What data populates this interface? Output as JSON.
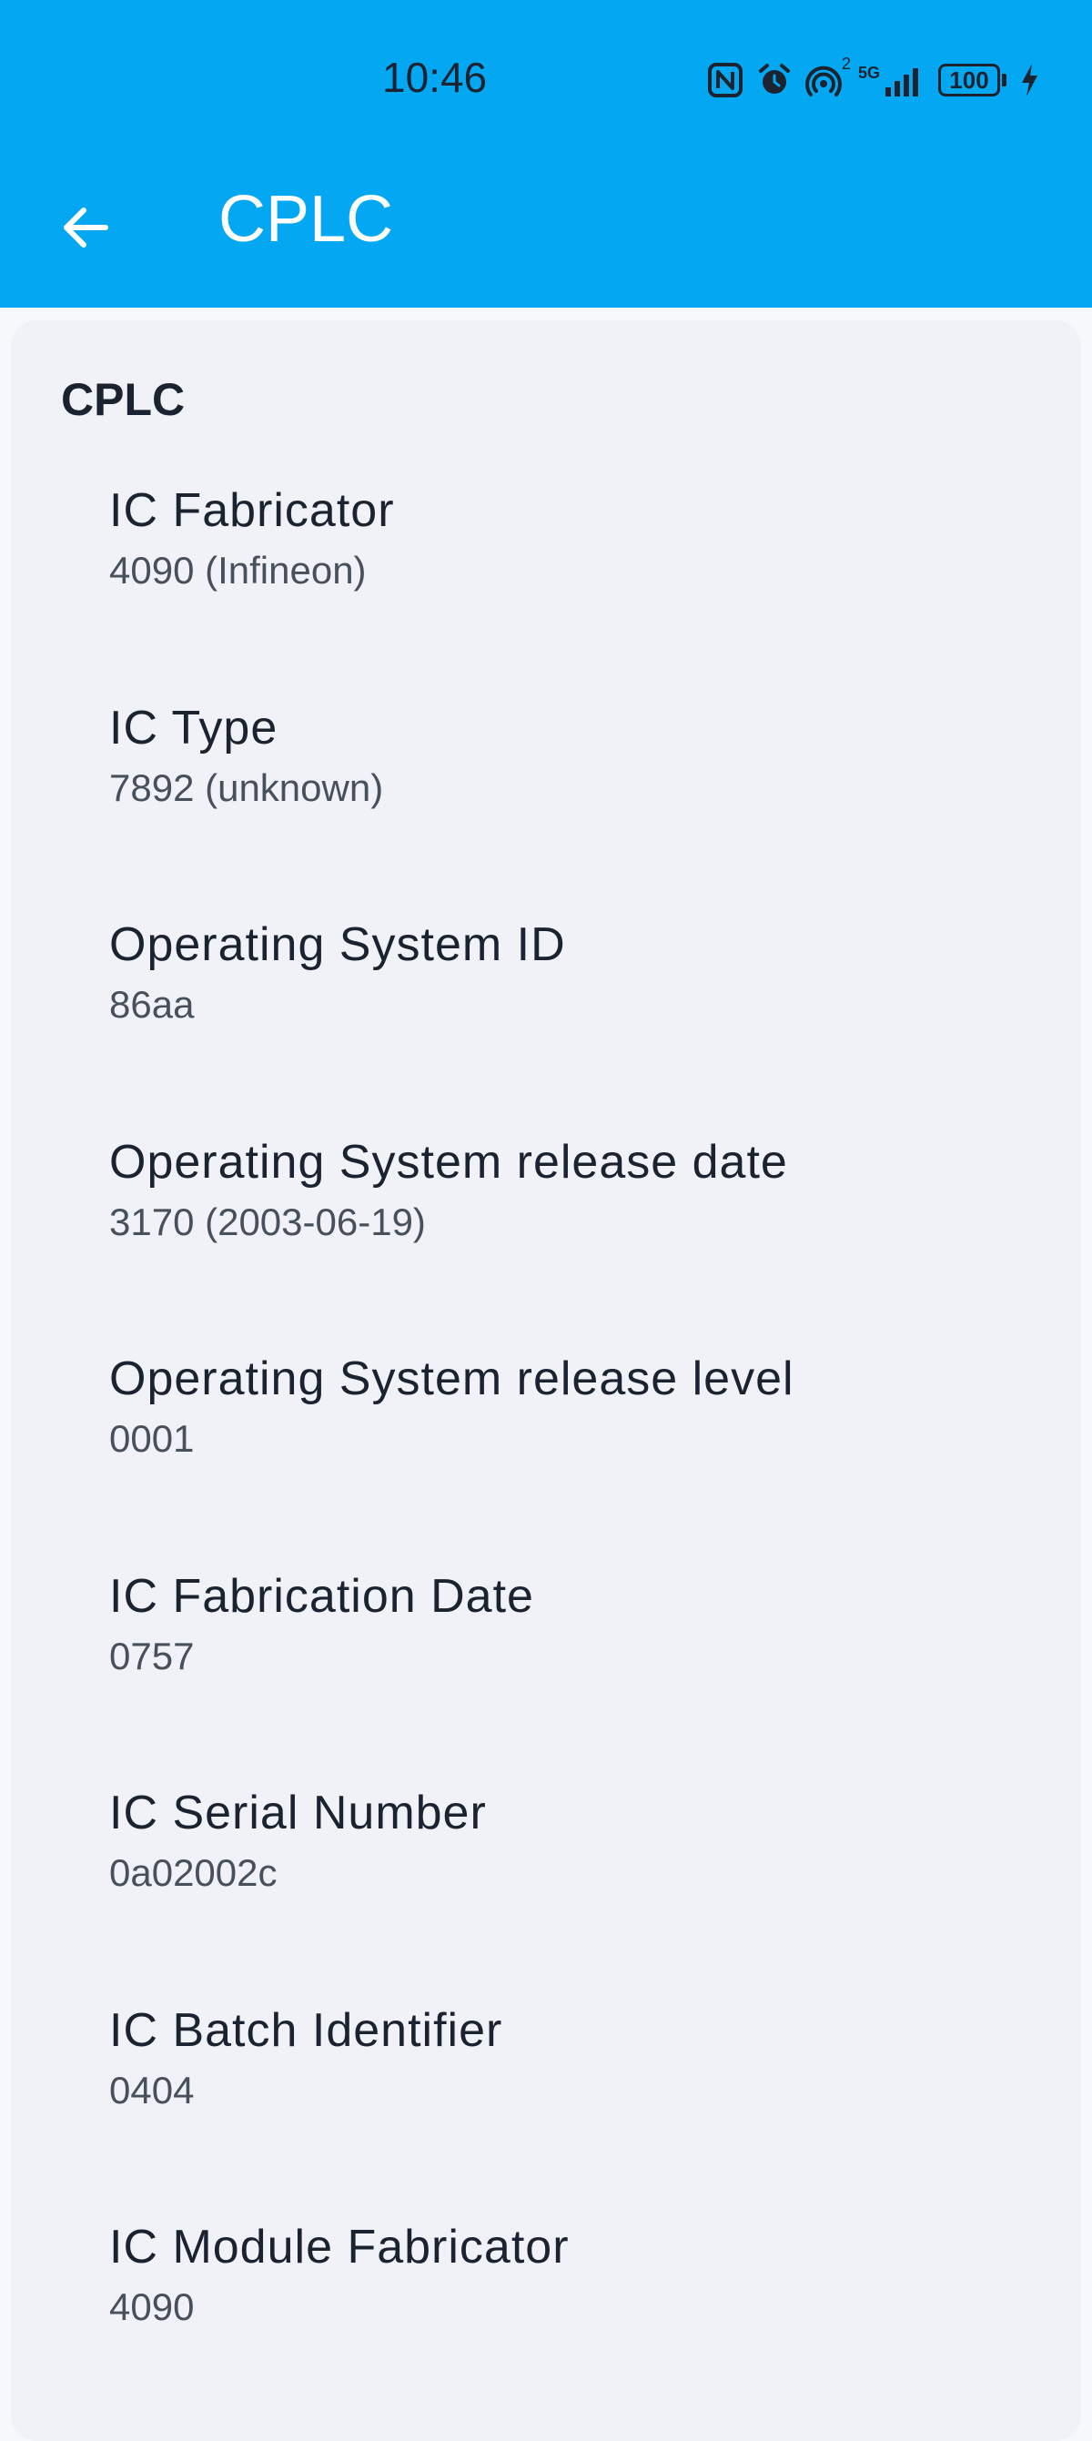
{
  "status_bar": {
    "time": "10:46",
    "icons": [
      "nfc-icon",
      "alarm-icon",
      "hotspot-icon",
      "signal-5g-icon"
    ],
    "hotspot_badge": "2",
    "network_label": "5G",
    "battery_level": "100"
  },
  "app_bar": {
    "back_icon": "arrow-left-icon",
    "title": "CPLC",
    "color": "#04a7f2"
  },
  "section": {
    "header": "CPLC",
    "items": [
      {
        "label": "IC Fabricator",
        "value": "4090 (Infineon)"
      },
      {
        "label": "IC Type",
        "value": "7892 (unknown)"
      },
      {
        "label": "Operating System ID",
        "value": "86aa"
      },
      {
        "label": "Operating System release date",
        "value": "3170 (2003-06-19)"
      },
      {
        "label": "Operating System release level",
        "value": "0001"
      },
      {
        "label": "IC Fabrication Date",
        "value": "0757"
      },
      {
        "label": "IC Serial Number",
        "value": "0a02002c"
      },
      {
        "label": "IC Batch Identifier",
        "value": "0404"
      },
      {
        "label": "IC Module Fabricator",
        "value": "4090"
      }
    ]
  }
}
